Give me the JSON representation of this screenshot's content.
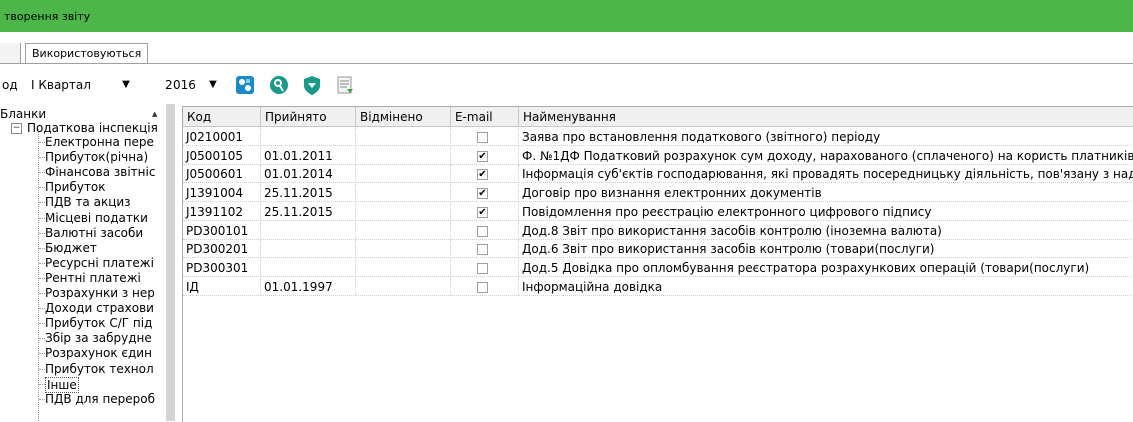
{
  "window": {
    "title": "творення звіту"
  },
  "tabs": [
    {
      "label": ""
    },
    {
      "label": "Використовуються"
    }
  ],
  "toolbar": {
    "period_label": "од",
    "period_value": "I Квартал",
    "year_prefix": "2",
    "year_value": "016"
  },
  "tree": {
    "root": "Бланки",
    "group": "Податкова інспекція",
    "items": [
      "Електронна пере",
      "Прибуток(річна)",
      "Фінансова звітніс",
      "Прибуток",
      "ПДВ та акциз",
      "Місцеві податки",
      "Валютні засоби",
      "Бюджет",
      "Ресурсні платежі",
      "Рентні платежі",
      "Розрахунки з нер",
      "Доходи страхови",
      "Прибуток С/Г під",
      "Збір за забрудне",
      "Розрахунок єдин",
      "Прибуток технол",
      "Інше",
      "ПДВ для перероб"
    ],
    "selected_index": 16
  },
  "grid": {
    "columns": [
      "Код",
      "Прийнято",
      "Відмінено",
      "E-mail",
      "Найменування"
    ],
    "rows": [
      {
        "code": "J0210001",
        "accepted": "",
        "cancelled": "",
        "email": false,
        "name": "Заява про встановлення податкового (звітного) періоду"
      },
      {
        "code": "J0500105",
        "accepted": "01.01.2011",
        "cancelled": "",
        "email": true,
        "name": " Ф. №1ДФ Податковий розрахунок сум доходу, нарахованого (сплаченого) на користь платників"
      },
      {
        "code": "J0500601",
        "accepted": "01.01.2014",
        "cancelled": "",
        "email": true,
        "name": " Інформація суб'єктів господарювання, які провадять посередницьку діяльність, пов'язану з нада"
      },
      {
        "code": "J1391004",
        "accepted": "25.11.2015",
        "cancelled": "",
        "email": true,
        "name": "Договір про визнання електронних документів"
      },
      {
        "code": "J1391102",
        "accepted": "25.11.2015",
        "cancelled": "",
        "email": true,
        "name": "Повідомлення про реєстрацію електронного цифрового підпису"
      },
      {
        "code": "PD300101",
        "accepted": "",
        "cancelled": "",
        "email": false,
        "name": "Дод.8 Звіт про використання засобів контролю (іноземна валюта)"
      },
      {
        "code": "PD300201",
        "accepted": "",
        "cancelled": "",
        "email": false,
        "name": "Дод.6 Звіт про використання засобів контролю (товари(послуги)"
      },
      {
        "code": "PD300301",
        "accepted": "",
        "cancelled": "",
        "email": false,
        "name": "Дод.5 Довідка про опломбування реєстратора розрахункових операцій (товари(послуги)"
      },
      {
        "code": "ІД",
        "accepted": "01.01.1997",
        "cancelled": "",
        "email": false,
        "name": "Інформаційна довідка"
      }
    ]
  },
  "colors": {
    "titlebar": "#4cb648",
    "accent_blue": "#1a8bc7",
    "accent_teal": "#1b9a8a"
  }
}
